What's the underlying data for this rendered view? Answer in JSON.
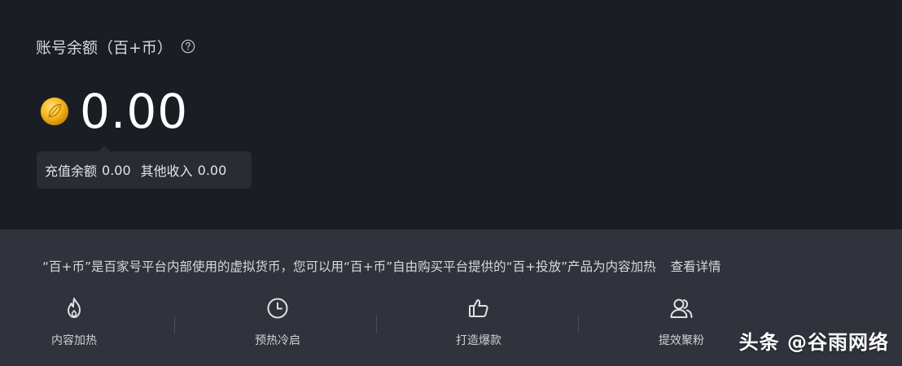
{
  "account": {
    "title": "账号余额（百+币）",
    "help_icon": "question-circle-icon",
    "coin_icon": "coin-icon",
    "balance": "0.00"
  },
  "tooltip": {
    "recharge_label": "充值余额",
    "recharge_value": "0.00",
    "other_label": "其他收入",
    "other_value": "0.00"
  },
  "description": {
    "text": "“百+币”是百家号平台内部使用的虚拟货币，您可以用“百+币”自由购买平台提供的“百+投放”产品为内容加热",
    "link": "查看详情"
  },
  "features": [
    {
      "label": "内容加热",
      "icon": "flame-icon"
    },
    {
      "label": "预热冷启",
      "icon": "clock-icon"
    },
    {
      "label": "打造爆款",
      "icon": "thumbs-up-icon"
    },
    {
      "label": "提效聚粉",
      "icon": "users-icon"
    }
  ],
  "watermark": "头条 @谷雨网络",
  "colors": {
    "top_bg": "#1b1d24",
    "bottom_bg": "#30333b",
    "coin_gold": "#f2b01e"
  }
}
